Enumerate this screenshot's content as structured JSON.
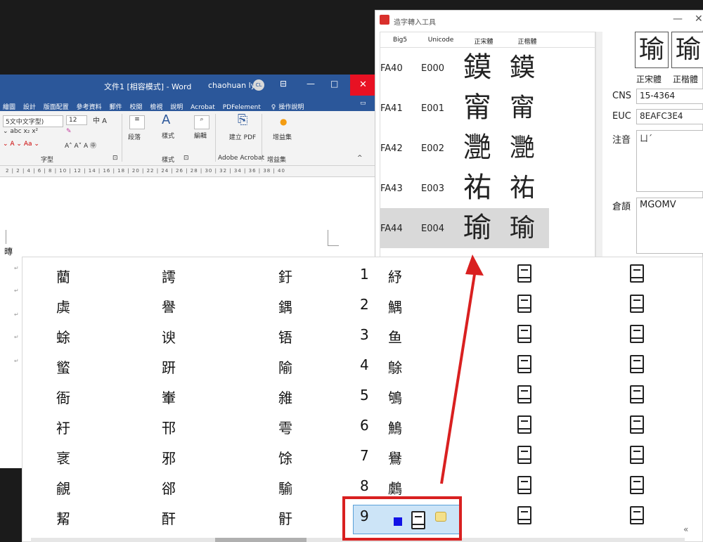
{
  "word": {
    "doc_title": "文件1 [相容模式] - Word",
    "user_name": "chaohuan ly",
    "avatar_initials": "CL",
    "minimize": "—",
    "restore": "□",
    "close": "✕",
    "tabs": [
      "繪圖",
      "設計",
      "版面配置",
      "參考資料",
      "郵件",
      "校閱",
      "檢視",
      "說明",
      "Acrobat",
      "PDFelement",
      "操作說明"
    ],
    "font_name": "5文中文字型)",
    "font_size": "12",
    "group_font": "字型",
    "group_styles": "樣式",
    "paragraph": "段落",
    "styles": "樣式",
    "edit": "編輯",
    "create_pdf": "建立 PDF",
    "addins": "增益集",
    "group_acrobat": "Adobe Acrobat",
    "group_addins": "增益集",
    "ruler": "2 | 2 | 4 | 6 | 8 | 10 | 12 | 14 | 16 | 18 | 20 | 22 | 24 | 26 | 28 | 30 | 32 | 34 | 36 | 38 | 40",
    "doc_text": "暷"
  },
  "tool": {
    "title": "造字轉入工具",
    "minimize": "—",
    "close": "✕",
    "headers": [
      "Big5",
      "Unicode",
      "正宋體",
      "正楷體"
    ],
    "rows": [
      {
        "big5": "FA40",
        "unicode": "E000",
        "song": "鏌",
        "kai": "鏌",
        "selected": false
      },
      {
        "big5": "FA41",
        "unicode": "E001",
        "song": "甯",
        "kai": "甯",
        "selected": false
      },
      {
        "big5": "FA42",
        "unicode": "E002",
        "song": "灧",
        "kai": "灧",
        "selected": false
      },
      {
        "big5": "FA43",
        "unicode": "E003",
        "song": "祐",
        "kai": "祐",
        "selected": false
      },
      {
        "big5": "FA44",
        "unicode": "E004",
        "song": "瑜",
        "kai": "瑜",
        "selected": true
      }
    ],
    "preview_song": "瑜",
    "preview_kai": "瑜",
    "label_song": "正宋體",
    "label_kai": "正楷體",
    "cns_label": "CNS",
    "cns_value": "15-4364",
    "euc_label": "EUC",
    "euc_value": "8EAFC3E4",
    "zhuyin_label": "注音",
    "zhuyin_value": "ㄩˊ",
    "cangjie_label": "倉頡",
    "cangjie_value": "MGOMV"
  },
  "candidates": {
    "col1": [
      "藺",
      "虡",
      "蜍",
      "螸",
      "衙",
      "衧",
      "衺",
      "覦",
      "觢"
    ],
    "col2": [
      "謣",
      "譽",
      "谀",
      "趼",
      "輋",
      "邗",
      "邪",
      "郤",
      "酐"
    ],
    "col3": [
      "釪",
      "鍝",
      "铻",
      "隃",
      "雓",
      "雩",
      "馀",
      "騟",
      "骬"
    ],
    "numbers": [
      "1",
      "2",
      "3",
      "4",
      "5",
      "6",
      "7",
      "8",
      "9"
    ],
    "col4": [
      "紓",
      "鰅",
      "鱼",
      "鵌",
      "鴝",
      "鷠",
      "鸒",
      "鸆",
      ""
    ],
    "collapse": "«"
  },
  "colors": {
    "word_blue": "#2b579a",
    "highlight_red": "#d92020",
    "selection_blue": "#cce4f7"
  }
}
